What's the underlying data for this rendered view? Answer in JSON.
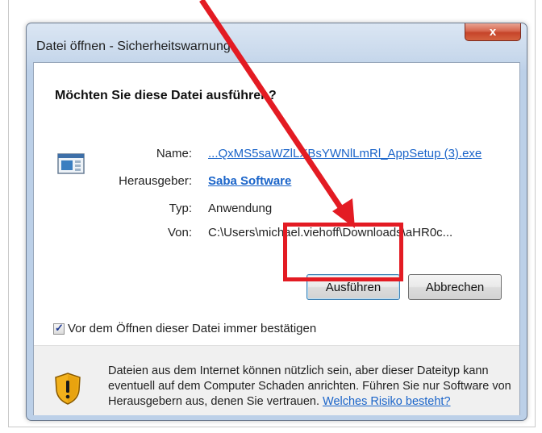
{
  "dialog": {
    "title": "Datei öffnen - Sicherheitswarnung",
    "close_label": "x",
    "heading": "Möchten Sie diese Datei ausführen?",
    "fields": [
      {
        "label": "Name:",
        "value": "...QxMS5saWZlLXBsYWNlLmRl_AppSetup (3).exe",
        "style": "link"
      },
      {
        "label": "Herausgeber:",
        "value": "Saba Software",
        "style": "bold-link"
      },
      {
        "label": "Typ:",
        "value": "Anwendung",
        "style": "plain"
      },
      {
        "label": "Von:",
        "value": "C:\\Users\\michael.viehoff\\Downloads\\aHR0c...",
        "style": "plain"
      }
    ],
    "run_label": "Ausführen",
    "cancel_label": "Abbrechen",
    "checkbox_label": "Vor dem Öffnen dieser Datei immer bestätigen",
    "checkbox_checked": true,
    "info_text": "Dateien aus dem Internet können nützlich sein, aber dieser Dateityp kann eventuell auf dem Computer Schaden anrichten. Führen Sie nur Software von Herausgebern aus, denen Sie vertrauen.",
    "info_link": "Welches Risiko besteht?",
    "icons": {
      "file": "application-file-icon",
      "shield": "warning-shield-icon",
      "close": "close-icon"
    }
  },
  "annotation": {
    "color": "#e31b23"
  }
}
